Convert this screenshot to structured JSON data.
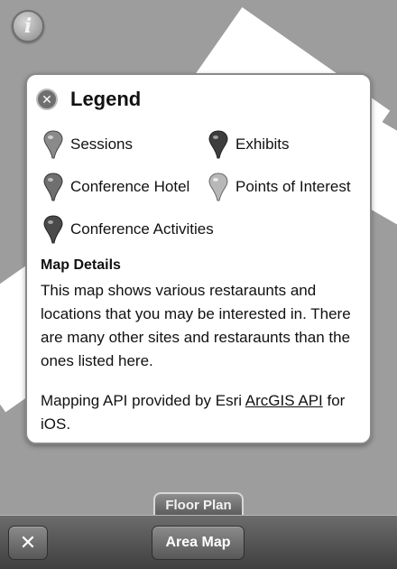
{
  "info_icon": "info-icon",
  "legend": {
    "title": "Legend",
    "close_icon": "close-circle-icon",
    "items": [
      {
        "label": "Sessions",
        "pin_color": "#8a8a8a"
      },
      {
        "label": "Exhibits",
        "pin_color": "#3d3d3d"
      },
      {
        "label": "Conference Hotel",
        "pin_color": "#6f6f6f"
      },
      {
        "label": "Points of Interest",
        "pin_color": "#b8b8b8"
      },
      {
        "label": "Conference Activities",
        "pin_color": "#4a4a4a"
      }
    ]
  },
  "details": {
    "title": "Map Details",
    "body": "This map shows various restaraunts and locations that you may be interested in. There are many other sites and restaraunts than the ones listed here.",
    "credit_prefix": "Mapping API provided by Esri ",
    "credit_link": "ArcGIS API",
    "credit_suffix": " for iOS."
  },
  "tabs": {
    "floor_plan": "Floor Plan"
  },
  "toolbar": {
    "close_glyph": "✕",
    "area_map": "Area Map"
  }
}
